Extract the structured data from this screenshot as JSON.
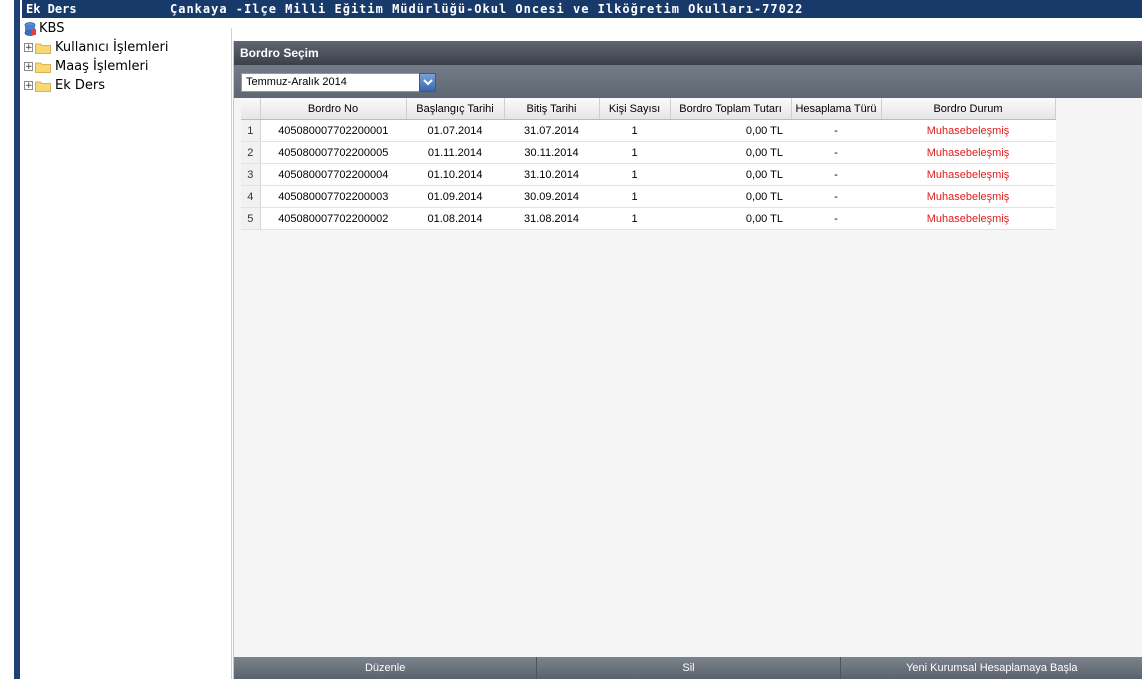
{
  "window": {
    "app_title": "Ek Ders",
    "org_title": "Çankaya -Ilçe Milli Eğitim Müdürlüğü-Okul Oncesi ve Ilköğretim Okulları-77022"
  },
  "tree": {
    "root": {
      "label": "KBS",
      "icon": "kbs-icon"
    },
    "items": [
      {
        "label": "Kullanıcı İşlemleri",
        "icon": "folder-icon"
      },
      {
        "label": "Maaş İşlemleri",
        "icon": "folder-icon"
      },
      {
        "label": "Ek Ders",
        "icon": "folder-icon"
      }
    ]
  },
  "panel": {
    "title": "Bordro Seçim",
    "period_select": {
      "value": "Temmuz-Aralık 2014"
    },
    "columns": [
      "Bordro No",
      "Başlangıç Tarihi",
      "Bitiş Tarihi",
      "Kişi Sayısı",
      "Bordro Toplam Tutarı",
      "Hesaplama Türü",
      "Bordro Durum"
    ],
    "rows": [
      {
        "n": "1",
        "bordro_no": "405080007702200001",
        "start": "01.07.2014",
        "end": "31.07.2014",
        "count": "1",
        "total": "0,00 TL",
        "calc": "-",
        "status": "Muhasebeleşmiş"
      },
      {
        "n": "2",
        "bordro_no": "405080007702200005",
        "start": "01.11.2014",
        "end": "30.11.2014",
        "count": "1",
        "total": "0,00 TL",
        "calc": "-",
        "status": "Muhasebeleşmiş"
      },
      {
        "n": "3",
        "bordro_no": "405080007702200004",
        "start": "01.10.2014",
        "end": "31.10.2014",
        "count": "1",
        "total": "0,00 TL",
        "calc": "-",
        "status": "Muhasebeleşmiş"
      },
      {
        "n": "4",
        "bordro_no": "405080007702200003",
        "start": "01.09.2014",
        "end": "30.09.2014",
        "count": "1",
        "total": "0,00 TL",
        "calc": "-",
        "status": "Muhasebeleşmiş"
      },
      {
        "n": "5",
        "bordro_no": "405080007702200002",
        "start": "01.08.2014",
        "end": "31.08.2014",
        "count": "1",
        "total": "0,00 TL",
        "calc": "-",
        "status": "Muhasebeleşmiş"
      }
    ],
    "buttons": {
      "edit": "Düzenle",
      "delete": "Sil",
      "new": "Yeni Kurumsal Hesaplamaya Başla"
    }
  },
  "colors": {
    "titlebar": "#183a6b",
    "status_text": "#e21c1c"
  }
}
